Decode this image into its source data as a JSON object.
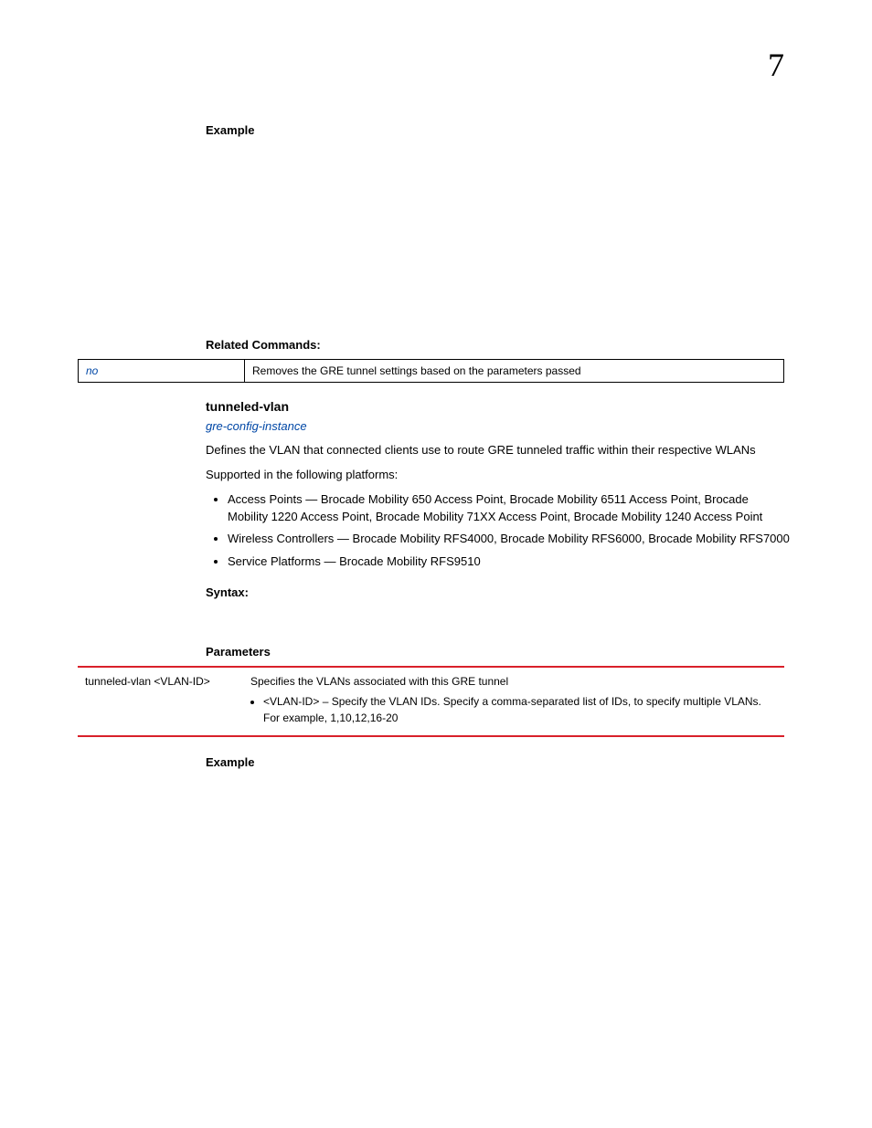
{
  "chapterNumber": "7",
  "section1": {
    "exampleHeading": "Example",
    "relatedHeading": "Related Commands:",
    "relatedTable": {
      "left": "no",
      "right": "Removes the GRE tunnel settings based on the parameters passed"
    }
  },
  "section2": {
    "title": "tunneled-vlan",
    "link": "gre-config-instance",
    "desc": "Defines the VLAN that connected clients use to route GRE tunneled traffic within their respective WLANs",
    "supported": "Supported in the following platforms:",
    "bullets": [
      "Access Points — Brocade Mobility 650 Access Point, Brocade Mobility 6511 Access Point, Brocade Mobility 1220 Access Point, Brocade Mobility 71XX Access Point, Brocade Mobility 1240 Access Point",
      "Wireless Controllers — Brocade Mobility RFS4000, Brocade Mobility RFS6000, Brocade Mobility RFS7000",
      "Service Platforms — Brocade Mobility RFS9510"
    ],
    "syntaxHeading": "Syntax:",
    "paramsHeading": "Parameters",
    "paramTable": {
      "left": "tunneled-vlan <VLAN-ID>",
      "rightIntro": "Specifies the VLANs associated with this GRE tunnel",
      "rightBullet": "<VLAN-ID> – Specify the VLAN IDs. Specify a comma-separated list of IDs, to specify multiple VLANs. For example, 1,10,12,16-20"
    },
    "exampleHeading": "Example"
  }
}
